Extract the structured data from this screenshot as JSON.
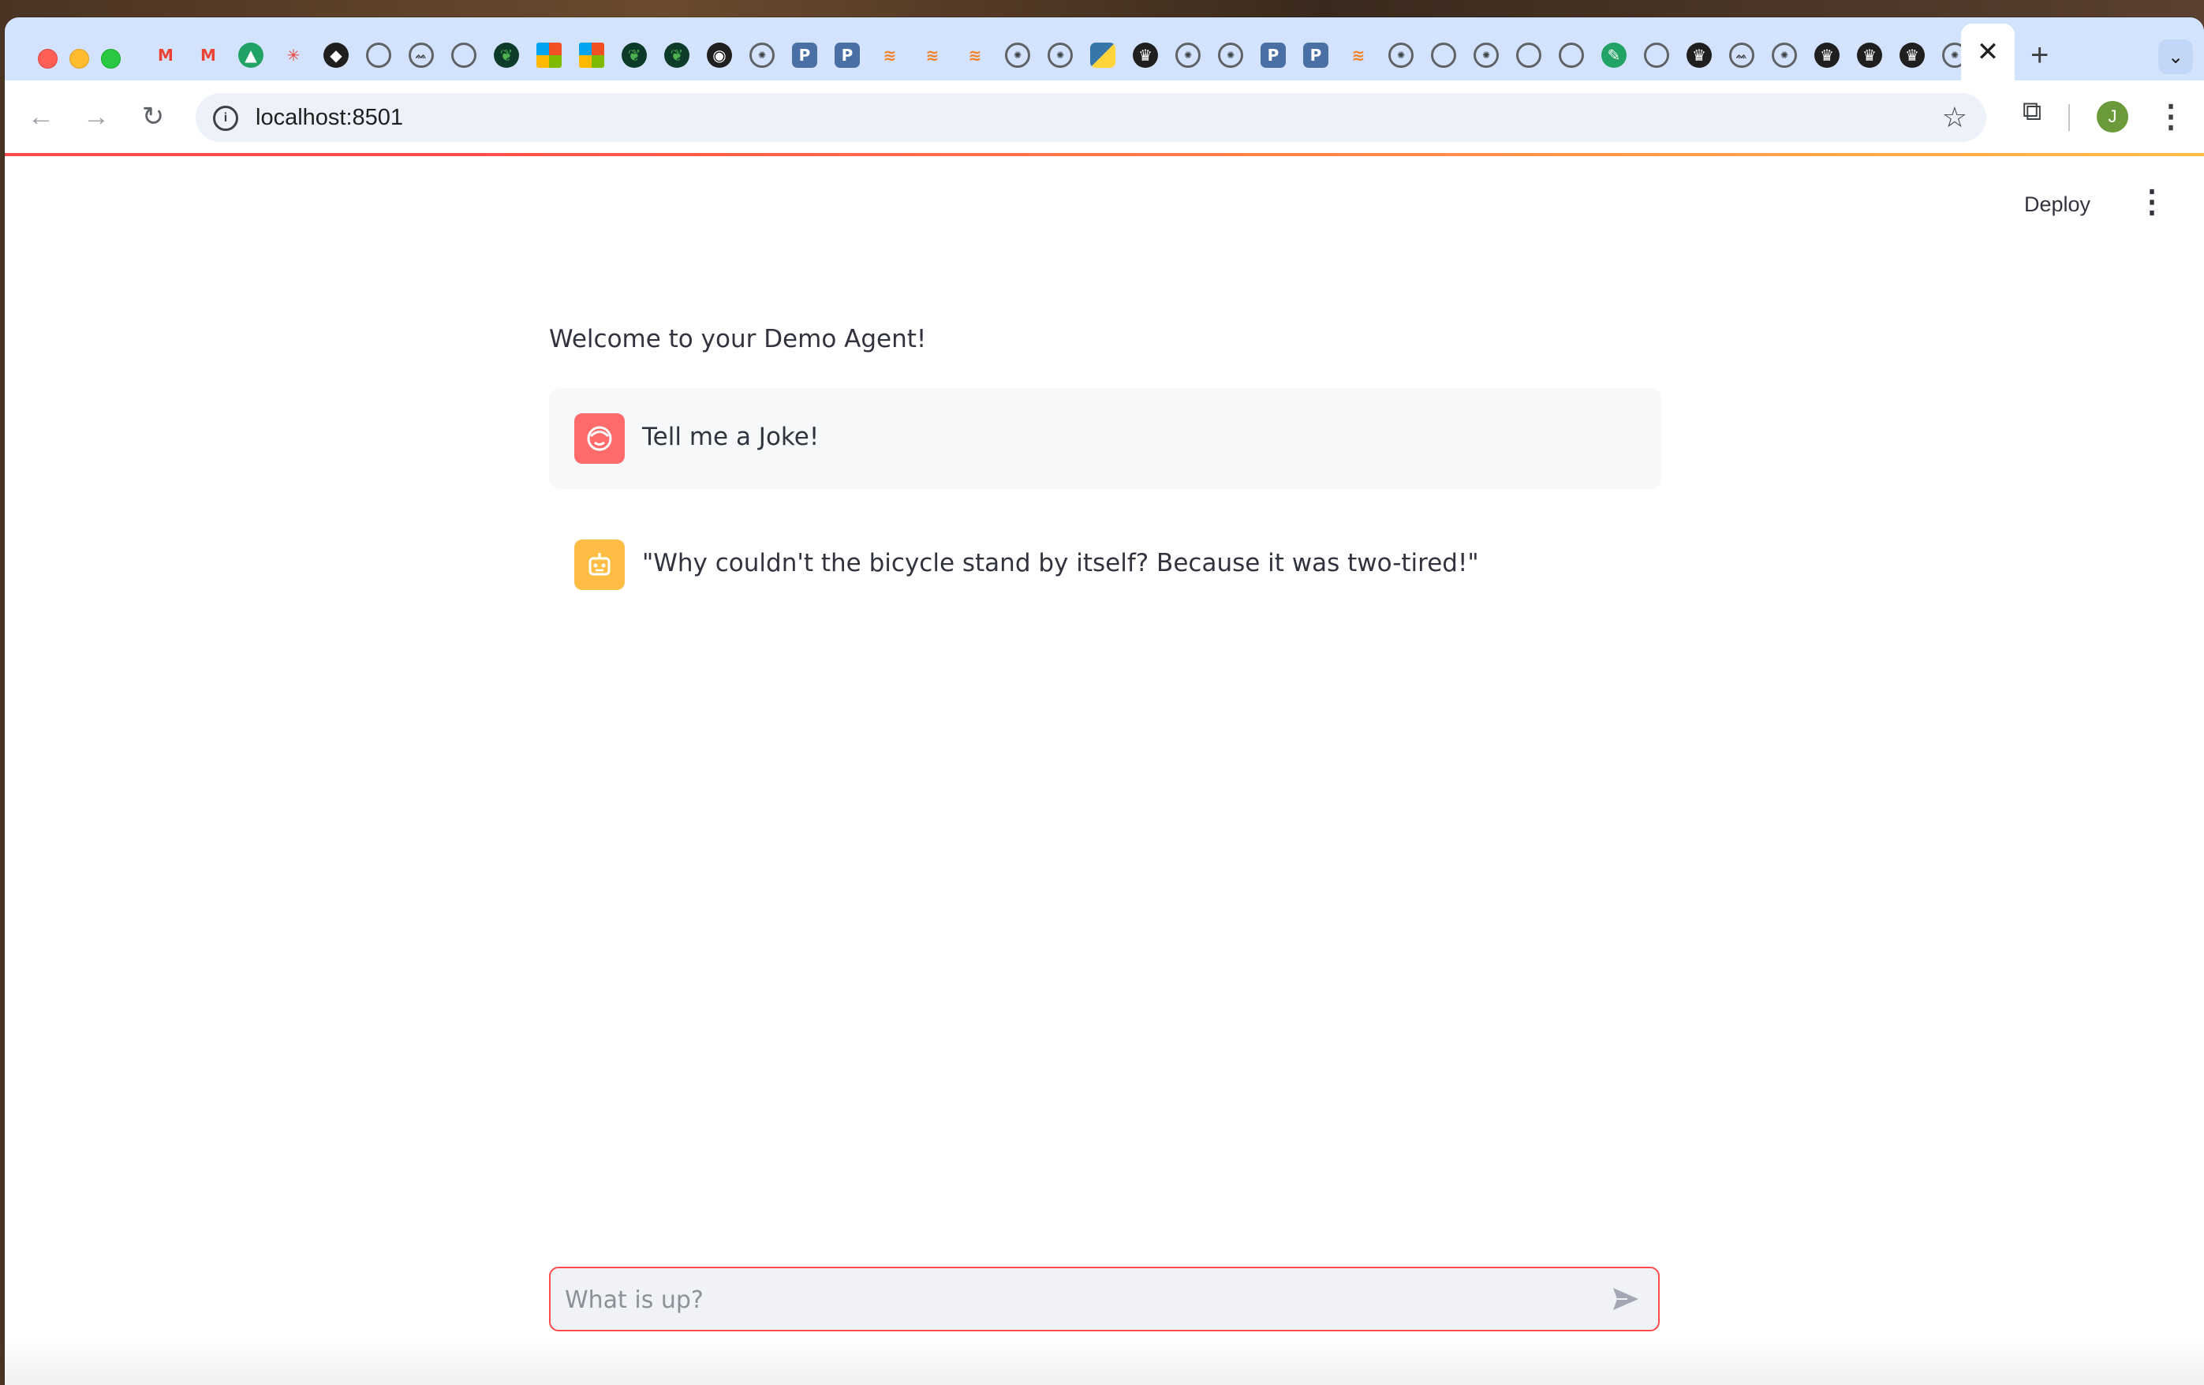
{
  "browser": {
    "url": "localhost:8501",
    "profile_initial": "J",
    "tab_favicons": [
      "gmail-icon",
      "gmail-icon",
      "drive-icon",
      "asterisk-icon",
      "cube-icon",
      "globe-icon",
      "cat-icon",
      "white-box-icon",
      "mongodb-icon",
      "microsoft-icon",
      "microsoft-icon",
      "mongodb-icon",
      "mongodb-icon",
      "github-icon",
      "openai-icon",
      "p-icon",
      "p-icon",
      "stackoverflow-icon",
      "stackoverflow-icon",
      "stackoverflow-icon",
      "openai-icon",
      "openai-icon",
      "python-icon",
      "crown-icon",
      "openai-icon",
      "openai-icon",
      "p-icon",
      "p-icon",
      "stackoverflow-icon",
      "openai-icon",
      "globe-icon",
      "openai-icon",
      "globe-icon",
      "globe-icon",
      "feather-icon",
      "globe-icon",
      "crown-icon",
      "cat-icon",
      "openai-icon",
      "crown-icon",
      "crown-icon",
      "crown-icon",
      "openai-icon"
    ],
    "active_tab_close": "✕",
    "new_tab": "+"
  },
  "app": {
    "deploy_label": "Deploy",
    "welcome": "Welcome to your Demo Agent!",
    "messages": [
      {
        "role": "user",
        "text": "Tell me a Joke!"
      },
      {
        "role": "assistant",
        "text": "\"Why couldn't the bicycle stand by itself? Because it was two-tired!\""
      }
    ],
    "chat_input": {
      "placeholder": "What is up?",
      "value": ""
    }
  },
  "colors": {
    "accent": "#ff4b4b",
    "user_avatar": "#ff6b6b",
    "assistant_avatar": "#ffbd45",
    "tabstrip": "#d3e3fd"
  }
}
